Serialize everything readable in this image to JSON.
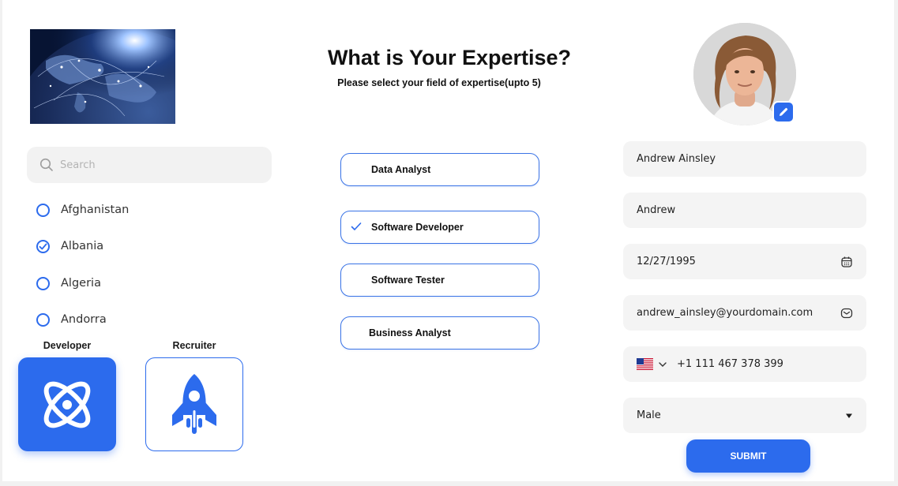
{
  "header": {
    "title": "What is Your Expertise?",
    "subtitle": "Please select your field of expertise(upto 5)"
  },
  "search": {
    "placeholder": "Search",
    "value": ""
  },
  "countries": [
    {
      "label": "Afghanistan",
      "checked": false
    },
    {
      "label": "Albania",
      "checked": true
    },
    {
      "label": "Algeria",
      "checked": false
    },
    {
      "label": "Andorra",
      "checked": false
    }
  ],
  "roles": [
    {
      "label": "Developer",
      "icon": "atom-icon",
      "selected": true
    },
    {
      "label": "Recruiter",
      "icon": "rocket-icon",
      "selected": false
    }
  ],
  "expertise": [
    {
      "label": "Data Analyst",
      "selected": false
    },
    {
      "label": "Software Developer",
      "selected": true
    },
    {
      "label": "Software Tester",
      "selected": false
    },
    {
      "label": "Business Analyst",
      "selected": false
    }
  ],
  "profile": {
    "full_name": "Andrew Ainsley",
    "nickname": "Andrew",
    "dob": "12/27/1995",
    "email": "andrew_ainsley@yourdomain.com",
    "phone_country_icon": "us-flag-icon",
    "phone": "+1 111 467 378 399",
    "gender": "Male"
  },
  "submit_label": "SUBMIT",
  "colors": {
    "accent": "#2c6bed",
    "field_bg": "#f4f4f4",
    "search_bg": "#f2f2f2"
  }
}
